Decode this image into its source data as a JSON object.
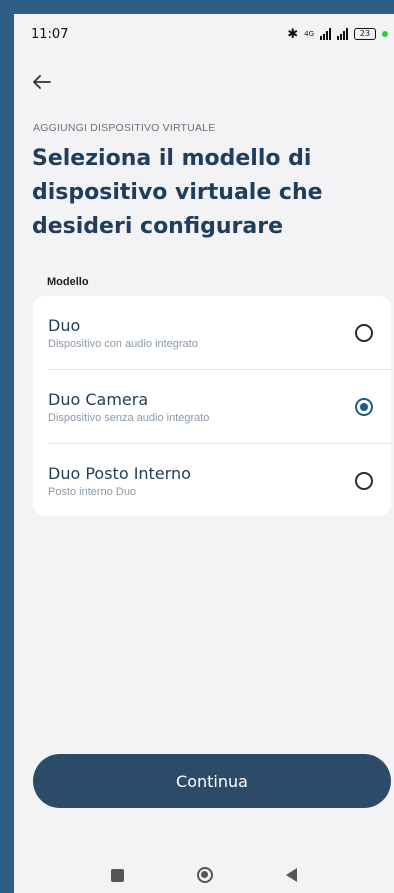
{
  "status_bar": {
    "time": "11:07",
    "battery": "23",
    "network": "4G"
  },
  "header": {
    "kicker": "AGGIUNGI DISPOSITIVO VIRTUALE",
    "title": "Seleziona il modello di dispositivo virtuale che desideri configurare"
  },
  "section": {
    "label": "Modello"
  },
  "options": [
    {
      "title": "Duo",
      "subtitle": "Dispositivo con audio integrato",
      "selected": false
    },
    {
      "title": "Duo Camera",
      "subtitle": "Dispositivo senza audio integrato",
      "selected": true
    },
    {
      "title": "Duo Posto Interno",
      "subtitle": "Posto interno Duo",
      "selected": false
    }
  ],
  "actions": {
    "continue_label": "Continua"
  },
  "colors": {
    "frame": "#2f5d86",
    "title": "#1f3d5c",
    "button": "#2c4b68",
    "radio_selected": "#1f5d86"
  }
}
